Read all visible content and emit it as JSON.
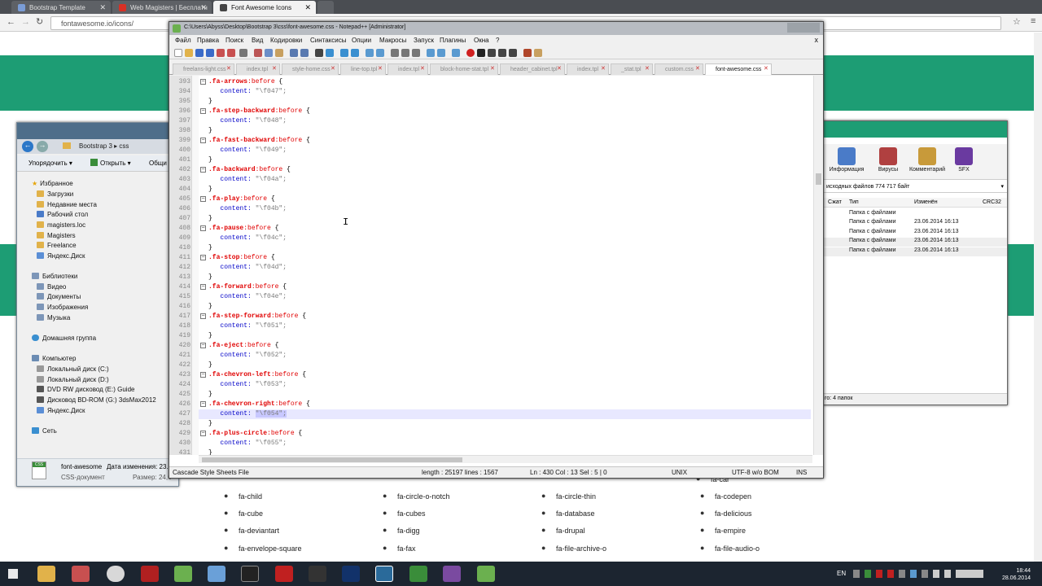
{
  "browser": {
    "tabs": [
      {
        "label": "Bootstrap Template",
        "color": "#7a9cd6"
      },
      {
        "label": "Web Magisters | Бесплатн",
        "color": "#d93025"
      },
      {
        "label": "Font Awesome Icons",
        "color": "#444"
      }
    ],
    "address": "fontawesome.io/icons/"
  },
  "site": {
    "icons_row1": [
      "fa-child",
      "fa-circle-o-notch",
      "fa-circle-thin",
      "fa-codepen"
    ],
    "icons_row2": [
      "fa-cube",
      "fa-cubes",
      "fa-database",
      "fa-delicious"
    ],
    "icons_row3": [
      "fa-deviantart",
      "fa-digg",
      "fa-drupal",
      "fa-empire"
    ],
    "icons_row4": [
      "fa-envelope-square",
      "fa-fax",
      "fa-file-archive-o",
      "fa-file-audio-o"
    ],
    "partial_top": "fa-car"
  },
  "explorer": {
    "breadcrumb": "Bootstrap 3  ▸  css",
    "toolbar": [
      "Упорядочить ▾",
      "Открыть ▾",
      "Общи"
    ],
    "tree": [
      {
        "label": "Избранное",
        "type": "star"
      },
      {
        "label": "Загрузки"
      },
      {
        "label": "Недавние места"
      },
      {
        "label": "Рабочий стол"
      },
      {
        "label": "magisters.loc"
      },
      {
        "label": "Magisters"
      },
      {
        "label": "Freelance"
      },
      {
        "label": "Яндекс.Диск"
      },
      {
        "label": "Библиотеки",
        "type": "lib"
      },
      {
        "label": "Видео"
      },
      {
        "label": "Документы"
      },
      {
        "label": "Изображения"
      },
      {
        "label": "Музыка"
      },
      {
        "label": "Домашняя группа",
        "type": "group"
      },
      {
        "label": "Компьютер",
        "type": "pc"
      },
      {
        "label": "Локальный диск (C:)"
      },
      {
        "label": "Локальный диск (D:)"
      },
      {
        "label": "DVD RW дисковод (E:) Guide"
      },
      {
        "label": "Дисковод BD-ROM (G:) 3dsMax2012"
      },
      {
        "label": "Яндекс.Диск"
      },
      {
        "label": "Сеть",
        "type": "net"
      }
    ],
    "status": {
      "name": "font-awesome",
      "modified": "Дата изменения: 23.0",
      "type": "CSS-документ",
      "size": "Размер: 24,6",
      "icon_label": "CSS"
    }
  },
  "winrar": {
    "tools": [
      "Информация",
      "Вирусы",
      "Комментарий",
      "SFX"
    ],
    "path": "исходных файлов 774 717 байт",
    "headers": [
      "Сжат",
      "Тип",
      "Изменён",
      "CRC32"
    ],
    "rows": [
      {
        "type": "Папка с файлами",
        "date": ""
      },
      {
        "type": "Папка с файлами",
        "date": "23.06.2014 16:13"
      },
      {
        "type": "Папка с файлами",
        "date": "23.06.2014 16:13"
      },
      {
        "type": "Папка с файлами",
        "date": "23.06.2014 16:13"
      },
      {
        "type": "Папка с файлами",
        "date": "23.06.2014 16:13"
      }
    ],
    "status": "го: 4 папок"
  },
  "npp": {
    "title": "C:\\Users\\Abyss\\Desktop\\Bootstrap 3\\css\\font-awesome.css - Notepad++ [Administrator]",
    "close": "x",
    "menu": [
      "Файл",
      "Правка",
      "Поиск",
      "Вид",
      "Кодировки",
      "Синтаксисы",
      "Опции",
      "Макросы",
      "Запуск",
      "Плагины",
      "Окна",
      "?"
    ],
    "tabs": [
      "freelans-light.css",
      "index.tpl",
      "style-home.css",
      "line-top.tpl",
      "index.tpl",
      "block-home-stat.tpl",
      "header_cabinet.tpl",
      "index.tpl",
      "_stat.tpl",
      "custom.css",
      "font-awesome.css"
    ],
    "lines": [
      {
        "n": "393",
        "kind": "sel",
        "name": ".fa-arrows",
        "fold": true
      },
      {
        "n": "394",
        "kind": "prop",
        "value": "\"\\f047\";"
      },
      {
        "n": "395",
        "kind": "close"
      },
      {
        "n": "396",
        "kind": "sel",
        "name": ".fa-step-backward",
        "fold": true
      },
      {
        "n": "397",
        "kind": "prop",
        "value": "\"\\f048\";"
      },
      {
        "n": "398",
        "kind": "close"
      },
      {
        "n": "399",
        "kind": "sel",
        "name": ".fa-fast-backward",
        "fold": true
      },
      {
        "n": "400",
        "kind": "prop",
        "value": "\"\\f049\";"
      },
      {
        "n": "401",
        "kind": "close"
      },
      {
        "n": "402",
        "kind": "sel",
        "name": ".fa-backward",
        "fold": true
      },
      {
        "n": "403",
        "kind": "prop",
        "value": "\"\\f04a\";"
      },
      {
        "n": "404",
        "kind": "close"
      },
      {
        "n": "405",
        "kind": "sel",
        "name": ".fa-play",
        "fold": true
      },
      {
        "n": "406",
        "kind": "prop",
        "value": "\"\\f04b\";"
      },
      {
        "n": "407",
        "kind": "close"
      },
      {
        "n": "408",
        "kind": "sel",
        "name": ".fa-pause",
        "fold": true
      },
      {
        "n": "409",
        "kind": "prop",
        "value": "\"\\f04c\";"
      },
      {
        "n": "410",
        "kind": "close"
      },
      {
        "n": "411",
        "kind": "sel",
        "name": ".fa-stop",
        "fold": true
      },
      {
        "n": "412",
        "kind": "prop",
        "value": "\"\\f04d\";"
      },
      {
        "n": "413",
        "kind": "close"
      },
      {
        "n": "414",
        "kind": "sel",
        "name": ".fa-forward",
        "fold": true
      },
      {
        "n": "415",
        "kind": "prop",
        "value": "\"\\f04e\";"
      },
      {
        "n": "416",
        "kind": "close"
      },
      {
        "n": "417",
        "kind": "sel",
        "name": ".fa-step-forward",
        "fold": true
      },
      {
        "n": "418",
        "kind": "prop",
        "value": "\"\\f051\";"
      },
      {
        "n": "419",
        "kind": "close"
      },
      {
        "n": "420",
        "kind": "sel",
        "name": ".fa-eject",
        "fold": true
      },
      {
        "n": "421",
        "kind": "prop",
        "value": "\"\\f052\";"
      },
      {
        "n": "422",
        "kind": "close"
      },
      {
        "n": "423",
        "kind": "sel",
        "name": ".fa-chevron-left",
        "fold": true
      },
      {
        "n": "424",
        "kind": "prop",
        "value": "\"\\f053\";"
      },
      {
        "n": "425",
        "kind": "close"
      },
      {
        "n": "426",
        "kind": "sel",
        "name": ".fa-chevron-right",
        "fold": true
      },
      {
        "n": "427",
        "kind": "prop",
        "value": "\"\\f054\";",
        "current": true
      },
      {
        "n": "428",
        "kind": "close"
      },
      {
        "n": "429",
        "kind": "sel",
        "name": ".fa-plus-circle",
        "fold": true
      },
      {
        "n": "430",
        "kind": "prop",
        "value": "\"\\f055\";"
      },
      {
        "n": "431",
        "kind": "close"
      }
    ],
    "pseudo": ":before",
    "prop_name": "content:",
    "status": {
      "filetype": "Cascade Style Sheets File",
      "length": "length : 25197   lines : 1567",
      "pos": "Ln : 430   Col : 13   Sel : 5 | 0",
      "eol": "UNIX",
      "enc": "UTF-8 w/o BOM",
      "ins": "INS"
    }
  },
  "taskbar": {
    "lang": "EN",
    "time": "18:44",
    "date": "28.06.2014"
  },
  "colors": {
    "site_green": "#1d9d74",
    "selector_red": "#e00000",
    "property_blue": "#0000c8"
  }
}
